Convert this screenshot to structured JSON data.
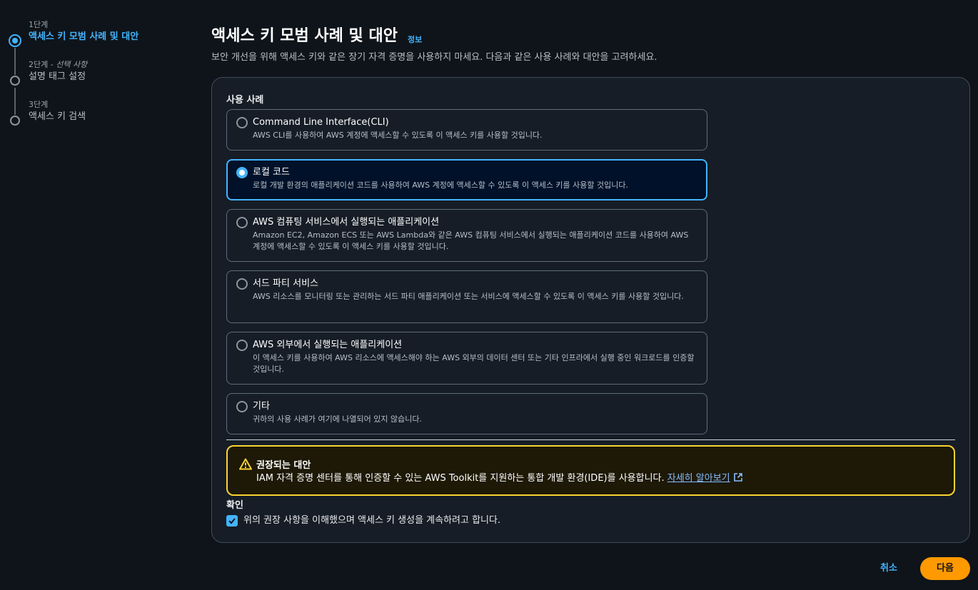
{
  "stepper": {
    "steps": [
      {
        "num": "1단계",
        "optional": "",
        "label": "액세스 키 모범 사례 및 대안"
      },
      {
        "num": "2단계 - ",
        "optional": "선택 사항",
        "label": "설명 태그 설정"
      },
      {
        "num": "3단계",
        "optional": "",
        "label": "액세스 키 검색"
      }
    ]
  },
  "header": {
    "title": "액세스 키 모범 사례 및 대안",
    "info_link": "정보",
    "description": "보안 개선을 위해 액세스 키와 같은 장기 자격 증명을 사용하지 마세요. 다음과 같은 사용 사례와 대안을 고려하세요."
  },
  "use_cases": {
    "label": "사용 사례",
    "options": [
      {
        "title": "Command Line Interface(CLI)",
        "desc": "AWS CLI를 사용하여 AWS 계정에 액세스할 수 있도록 이 액세스 키를 사용할 것입니다."
      },
      {
        "title": "로컬 코드",
        "desc": "로컬 개발 환경의 애플리케이션 코드를 사용하여 AWS 계정에 액세스할 수 있도록 이 액세스 키를 사용할 것입니다."
      },
      {
        "title": "AWS 컴퓨팅 서비스에서 실행되는 애플리케이션",
        "desc": "Amazon EC2, Amazon ECS 또는 AWS Lambda와 같은 AWS 컴퓨팅 서비스에서 실행되는 애플리케이션 코드를 사용하여 AWS 계정에 액세스할 수 있도록 이 액세스 키를 사용할 것입니다."
      },
      {
        "title": "서드 파티 서비스",
        "desc": "AWS 리소스를 모니터링 또는 관리하는 서드 파티 애플리케이션 또는 서비스에 액세스할 수 있도록 이 액세스 키를 사용할 것입니다."
      },
      {
        "title": "AWS 외부에서 실행되는 애플리케이션",
        "desc": "이 액세스 키를 사용하여 AWS 리소스에 액세스해야 하는 AWS 외부의 데이터 센터 또는 기타 인프라에서 실행 중인 워크로드를 인증할 것입니다."
      },
      {
        "title": "기타",
        "desc": "귀하의 사용 사례가 여기에 나열되어 있지 않습니다."
      }
    ],
    "selected": "로컬 코드"
  },
  "alert": {
    "title": "권장되는 대안",
    "body": "IAM 자격 증명 센터를 통해 인증할 수 있는 AWS Toolkit를 지원하는 통합 개발 환경(IDE)를 사용합니다. ",
    "link": "자세히 알아보기",
    "color": "#fbd332"
  },
  "confirm": {
    "label": "확인",
    "checkbox_text": "위의 권장 사항을 이해했으며 액세스 키 생성을 계속하려고 합니다.",
    "checked": true
  },
  "footer": {
    "cancel": "취소",
    "next": "다음"
  },
  "colors": {
    "accent": "#42b4ff",
    "primary_button": "#ff9900",
    "background": "#0f141a"
  }
}
